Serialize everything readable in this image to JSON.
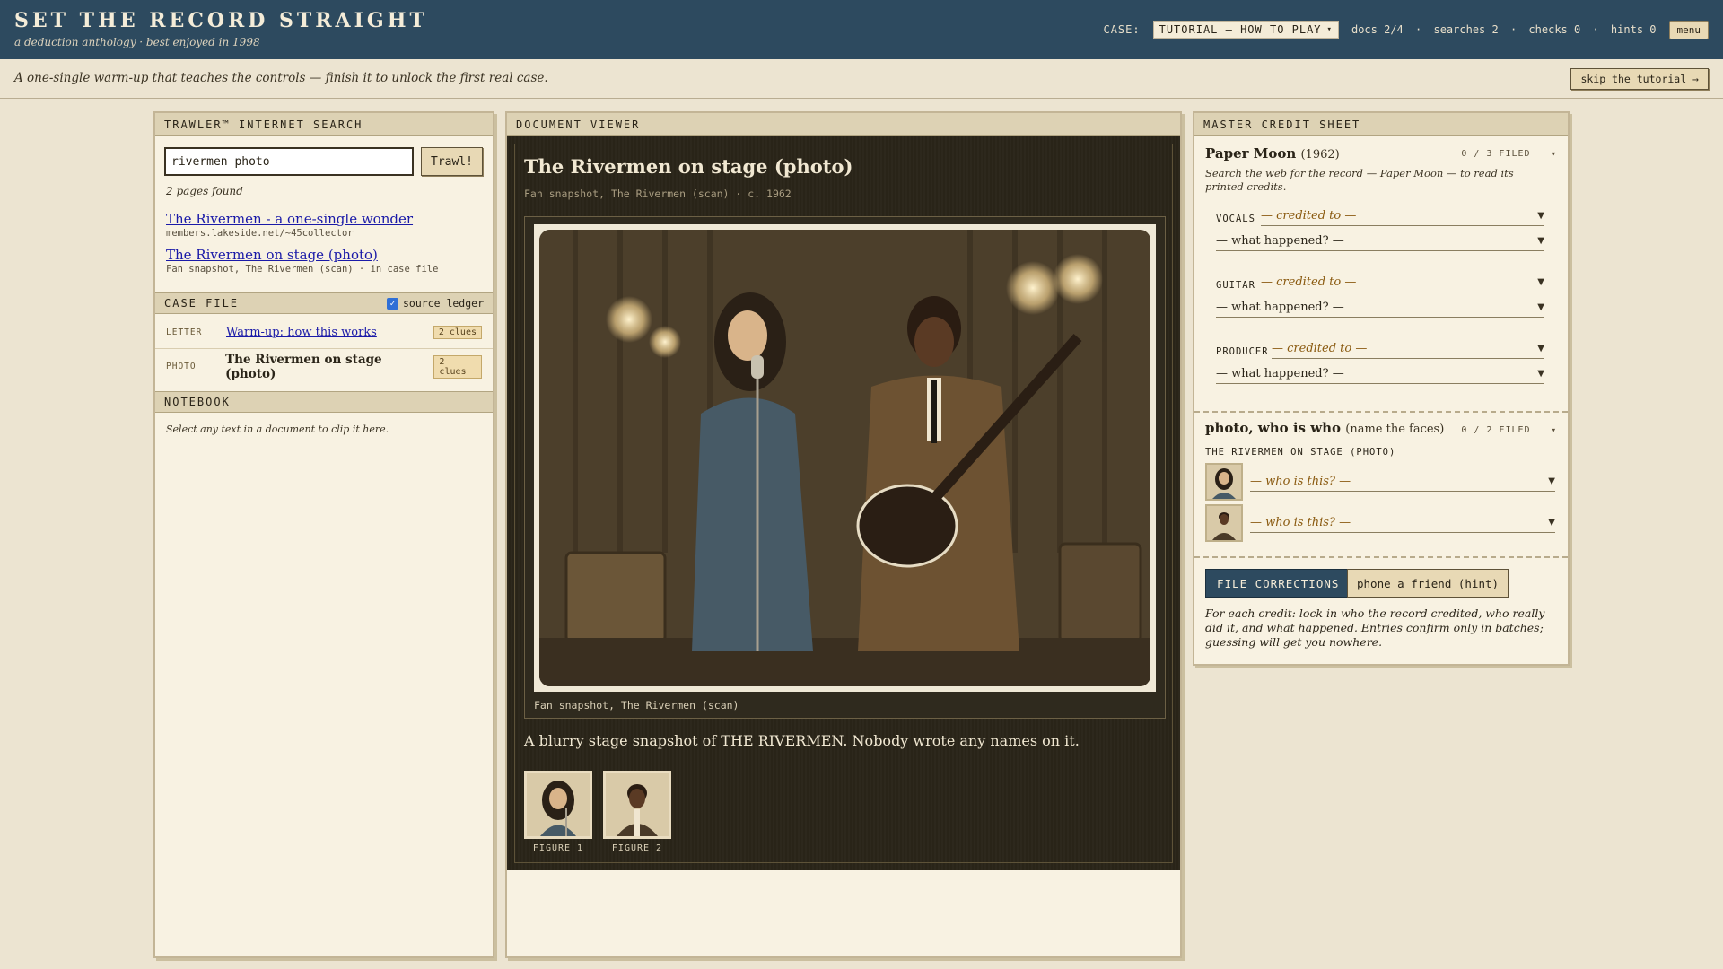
{
  "header": {
    "title": "SET THE RECORD STRAIGHT",
    "subtitle": "a deduction anthology · best enjoyed in 1998",
    "case_label": "CASE:",
    "case_value": "TUTORIAL — HOW TO PLAY",
    "stats": {
      "docs": "docs 2/4",
      "searches": "searches 2",
      "checks": "checks 0",
      "hints": "hints 0",
      "separator": "·"
    },
    "menu_label": "menu"
  },
  "intro": {
    "text": "A one-single warm-up that teaches the controls — finish it to unlock the first real case.",
    "skip_label": "skip the tutorial →"
  },
  "search_panel": {
    "header": "TRAWLER™ INTERNET SEARCH",
    "query": "rivermen photo",
    "button": "Trawl!",
    "found_text": "2 pages found",
    "results": [
      {
        "title": "The Rivermen - a one-single wonder",
        "url": "members.lakeside.net/~45collector"
      },
      {
        "title": "The Rivermen on stage (photo)",
        "url": "Fan snapshot, The Rivermen (scan) · in case file"
      }
    ]
  },
  "case_file": {
    "header": "CASE FILE",
    "ledger_label": "source ledger",
    "ledger_checked": true,
    "items": [
      {
        "type": "LETTER",
        "title": "Warm-up: how this works",
        "clues": "2 clues"
      },
      {
        "type": "PHOTO",
        "title": "The Rivermen on stage (photo)",
        "clues": "2 clues"
      }
    ]
  },
  "notebook": {
    "header": "NOTEBOOK",
    "hint": "Select any text in a document to clip it here."
  },
  "viewer": {
    "header": "DOCUMENT VIEWER",
    "title": "The Rivermen on stage (photo)",
    "subtitle": "Fan snapshot, The Rivermen (scan) · c. 1962",
    "caption": "Fan snapshot, The Rivermen (scan)",
    "description": "A blurry stage snapshot of THE RIVERMEN. Nobody wrote any names on it.",
    "figures": [
      {
        "label": "FIGURE 1"
      },
      {
        "label": "FIGURE 2"
      }
    ]
  },
  "credit_sheet": {
    "header": "MASTER CREDIT SHEET",
    "record": {
      "title": "Paper Moon",
      "year": "(1962)",
      "filed": "0 / 3 FILED",
      "note": "Search the web for the record — Paper Moon — to read its printed credits.",
      "roles": [
        {
          "role": "VOCALS",
          "credited": "— credited to —",
          "happened": "— what happened? —"
        },
        {
          "role": "GUITAR",
          "credited": "— credited to —",
          "happened": "— what happened? —"
        },
        {
          "role": "PRODUCER",
          "credited": "— credited to —",
          "happened": "— what happened? —"
        }
      ]
    },
    "photo_section": {
      "title": "photo, who is who",
      "title_note": "(name the faces)",
      "filed": "0 / 2 FILED",
      "subcaption": "THE RIVERMEN ON STAGE (PHOTO)",
      "faces": [
        {
          "placeholder": "— who is this? —"
        },
        {
          "placeholder": "— who is this? —"
        }
      ]
    },
    "file_button": "FILE CORRECTIONS",
    "hint_button": "phone a friend (hint)",
    "instructions": "For each credit: lock in who the record credited, who really did it, and what happened. Entries confirm only in batches; guessing will get you nowhere."
  },
  "colors": {
    "header_bg": "#2d4a5f",
    "page_bg": "#ece4d1",
    "panel_bg": "#f8f2e2",
    "viewer_bg": "#2a2519",
    "link": "#1a1aa8",
    "accent_gold": "#8a5a10"
  }
}
